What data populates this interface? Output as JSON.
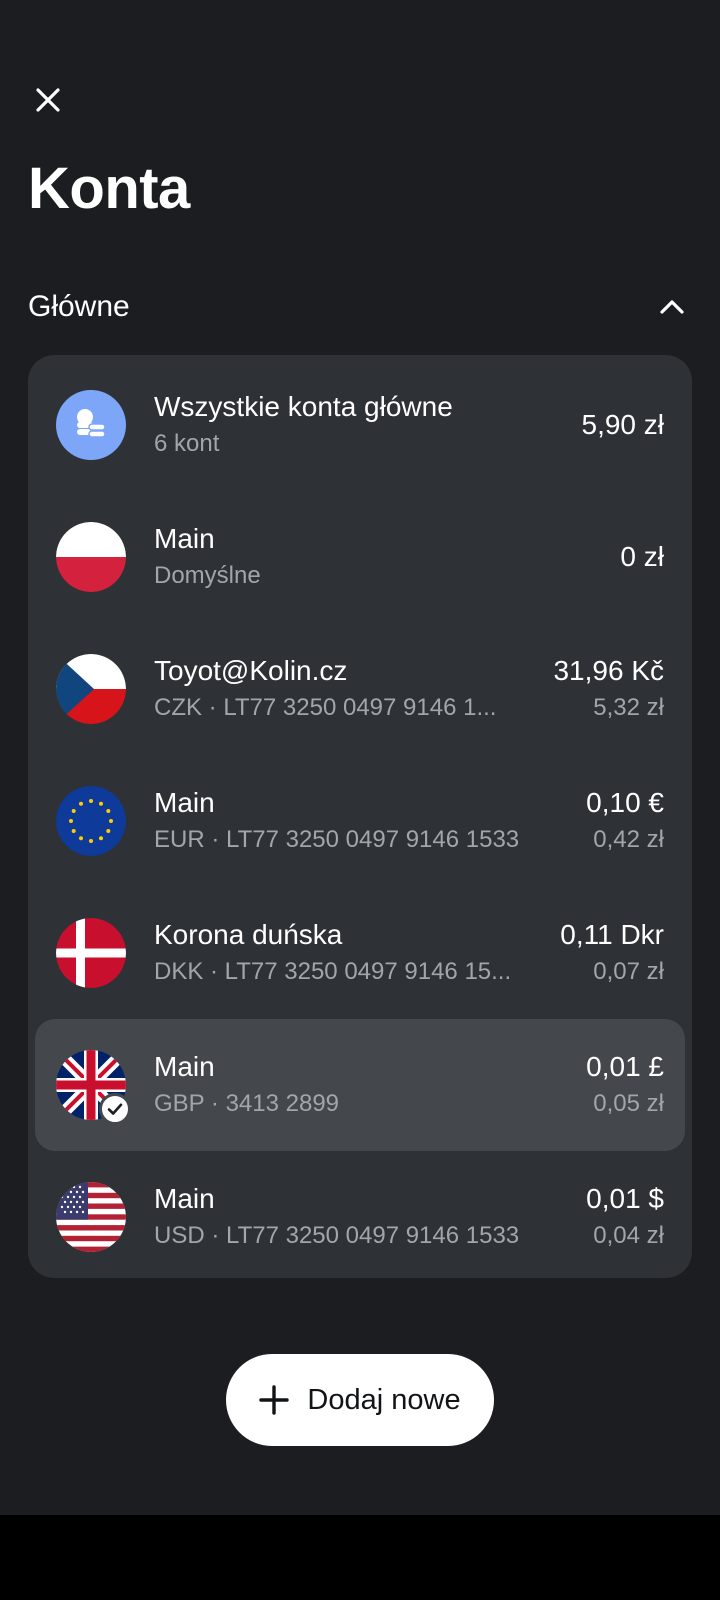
{
  "header": {
    "title": "Konta",
    "close_icon": "close-icon"
  },
  "section": {
    "title": "Główne",
    "collapse_icon": "chevron-up-icon"
  },
  "accounts": [
    {
      "name": "Wszystkie konta główne",
      "sub": "6 kont",
      "amount": "5,90 zł",
      "amount_sub": "",
      "icon": "coins-icon"
    },
    {
      "name": "Main",
      "sub": "Domyślne",
      "amount": "0 zł",
      "amount_sub": "",
      "icon": "poland-flag-icon"
    },
    {
      "name": "Toyot@Kolin.cz",
      "sub": "CZK · LT77 3250 0497 9146 1...",
      "amount": "31,96 Kč",
      "amount_sub": "5,32 zł",
      "icon": "czech-flag-icon"
    },
    {
      "name": "Main",
      "sub": "EUR · LT77 3250 0497 9146 1533",
      "amount": "0,10 €",
      "amount_sub": "0,42 zł",
      "icon": "eu-flag-icon"
    },
    {
      "name": "Korona duńska",
      "sub": "DKK · LT77 3250 0497 9146 15...",
      "amount": "0,11 Dkr",
      "amount_sub": "0,07 zł",
      "icon": "denmark-flag-icon"
    },
    {
      "name": "Main",
      "sub": "GBP · 3413 2899",
      "amount": "0,01 £",
      "amount_sub": "0,05 zł",
      "icon": "uk-flag-icon",
      "selected": true
    },
    {
      "name": "Main",
      "sub": "USD · LT77 3250 0497 9146 1533",
      "amount": "0,01 $",
      "amount_sub": "0,04 zł",
      "icon": "us-flag-icon"
    }
  ],
  "add_button": {
    "label": "Dodaj nowe",
    "icon": "plus-icon"
  },
  "colors": {
    "background": "#1b1d20",
    "card": "#2e3135",
    "selected": "#44474b",
    "accent": "#7ea6f8"
  }
}
